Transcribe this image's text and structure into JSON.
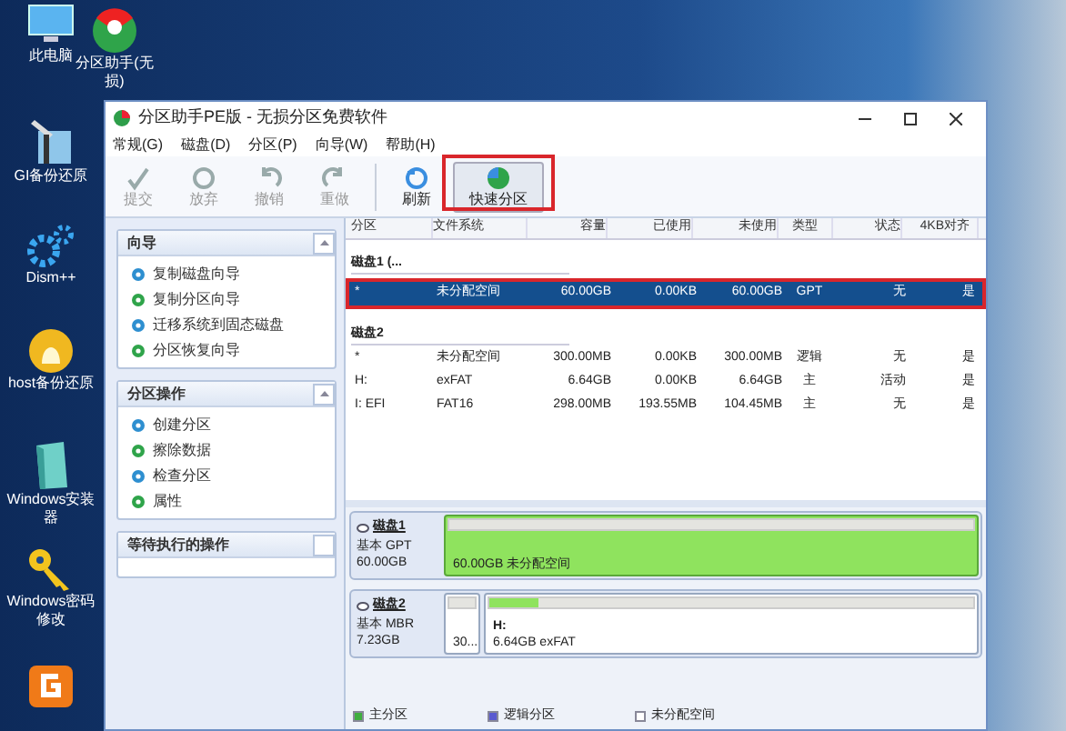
{
  "desktop_icons": [
    {
      "label": "此电脑",
      "kind": "pc"
    },
    {
      "label": "GI备份还原",
      "kind": "tool"
    },
    {
      "label": "Dism++",
      "kind": "gear"
    },
    {
      "label": "host备份还原",
      "kind": "ghost"
    },
    {
      "label": "Windows安装器",
      "kind": "installer"
    },
    {
      "label": "Windows密码修改",
      "kind": "key"
    },
    {
      "kind": "orange"
    }
  ],
  "desktop_icon_top": {
    "label": "分区助手(无损)",
    "kind": "disk"
  },
  "window": {
    "title": "分区助手PE版 - 无损分区免费软件"
  },
  "menu": [
    "常规(G)",
    "磁盘(D)",
    "分区(P)",
    "向导(W)",
    "帮助(H)"
  ],
  "toolbar": [
    {
      "label": "提交",
      "disabled": true,
      "highlighted": false
    },
    {
      "label": "放弃",
      "disabled": true,
      "highlighted": false
    },
    {
      "label": "撤销",
      "disabled": true,
      "highlighted": false
    },
    {
      "label": "重做",
      "disabled": true,
      "highlighted": false
    },
    {
      "label": "刷新",
      "disabled": false,
      "highlighted": false
    },
    {
      "label": "快速分区",
      "disabled": false,
      "highlighted": true
    }
  ],
  "panels": [
    {
      "title": "向导",
      "items": [
        "复制磁盘向导",
        "复制分区向导",
        "迁移系统到固态磁盘",
        "分区恢复向导"
      ]
    },
    {
      "title": "分区操作",
      "items": [
        "创建分区",
        "擦除数据",
        "检查分区",
        "属性"
      ]
    },
    {
      "title": "等待执行的操作"
    }
  ],
  "table": {
    "columns": [
      "分区",
      "文件系统",
      "容量",
      "已使用",
      "未使用",
      "类型",
      "状态",
      "4KB对齐"
    ],
    "groups": [
      {
        "disk": "磁盘1 (...",
        "rows": [
          {
            "cells": [
              "*",
              "未分配空间",
              "60.00GB",
              "0.00KB",
              "60.00GB",
              "GPT",
              "无",
              "是"
            ],
            "selected": true
          }
        ]
      },
      {
        "disk": "磁盘2",
        "rows": [
          {
            "cells": [
              "*",
              "未分配空间",
              "300.00MB",
              "0.00KB",
              "300.00MB",
              "逻辑",
              "无",
              "是"
            ],
            "selected": false
          },
          {
            "cells": [
              "H:",
              "exFAT",
              "6.64GB",
              "0.00KB",
              "6.64GB",
              "主",
              "活动",
              "是"
            ],
            "selected": false
          },
          {
            "cells": [
              "I: EFI",
              "FAT16",
              "298.00MB",
              "193.55MB",
              "104.45MB",
              "主",
              "无",
              "是"
            ],
            "selected": false
          }
        ]
      }
    ]
  },
  "disk_map": [
    {
      "name": "磁盘1",
      "type": "基本 GPT",
      "size": "60.00GB",
      "parts": [
        {
          "text": "60.00GB 未分配空间",
          "kind": "free",
          "wide": true
        }
      ]
    },
    {
      "name": "磁盘2",
      "type": "基本 MBR",
      "size": "7.23GB",
      "parts": [
        {
          "text": "30...",
          "kind": "small",
          "wide": false
        },
        {
          "label": "H:",
          "text": "6.64GB exFAT",
          "kind": "primary",
          "level": 0.1,
          "wide": true
        }
      ]
    }
  ],
  "legend": [
    {
      "label": "主分区",
      "color": "#3fae3f"
    },
    {
      "label": "逻辑分区",
      "color": "#5a5ad0"
    },
    {
      "label": "未分配空间",
      "color": "#ffffff"
    }
  ]
}
